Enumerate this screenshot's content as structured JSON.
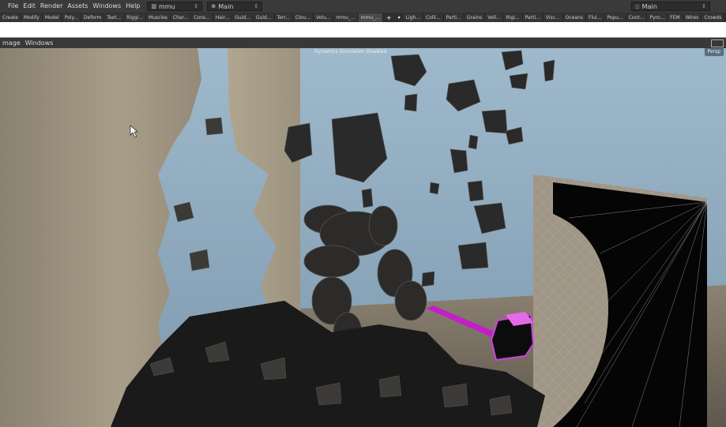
{
  "menubar": {
    "items": [
      "File",
      "Edit",
      "Render",
      "Assets",
      "Windows",
      "Help"
    ],
    "desktop_dropdown": "mmu",
    "context_dropdown": "Main",
    "right_dropdown": "Main"
  },
  "shelf": {
    "left_tabs": [
      "Create",
      "Modify",
      "Model",
      "Poly...",
      "Deform",
      "Text...",
      "Riggi...",
      "Muscles",
      "Char...",
      "Cons...",
      "Hair...",
      "Guid...",
      "Guid...",
      "Terr...",
      "Clou...",
      "Volu...",
      "mmu_...",
      "mmu_..."
    ],
    "right_tabs": [
      "Ligh...",
      "Colli...",
      "Parti...",
      "Grains",
      "Vell...",
      "Rigi...",
      "Parti...",
      "Visc...",
      "Oceans",
      "Flui...",
      "Popu...",
      "Cont...",
      "Pyro...",
      "FEM",
      "Wires",
      "Crowds"
    ]
  },
  "pane": {
    "tabs": [
      "mage",
      "Windows"
    ]
  },
  "viewport": {
    "status": "Dynamics Simulation Disabled",
    "camera": "Persp"
  }
}
